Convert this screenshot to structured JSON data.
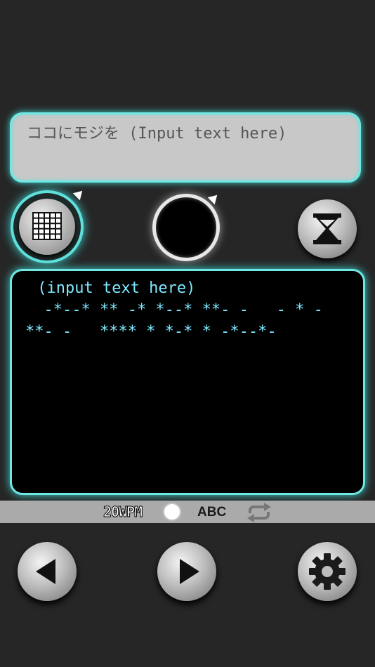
{
  "input": {
    "text": "ココにモジを (Input text here)"
  },
  "buttons": {
    "grid": "grid-icon",
    "key": "morse-key",
    "timer": "hourglass-icon"
  },
  "output": {
    "line1": " (input text here)",
    "line2": "  -*--* ** -* *--* **- -   - * -",
    "line3": "**- -   **** * *-* * -*--*-"
  },
  "status": {
    "wpm": "20WPM",
    "mode": "ABC"
  },
  "controls": {
    "prev": "left-triangle-icon",
    "play": "right-triangle-icon",
    "settings": "gear-icon"
  },
  "colors": {
    "accent": "#6fe8e4",
    "morse": "#7ee8ff",
    "background": "#262626"
  }
}
